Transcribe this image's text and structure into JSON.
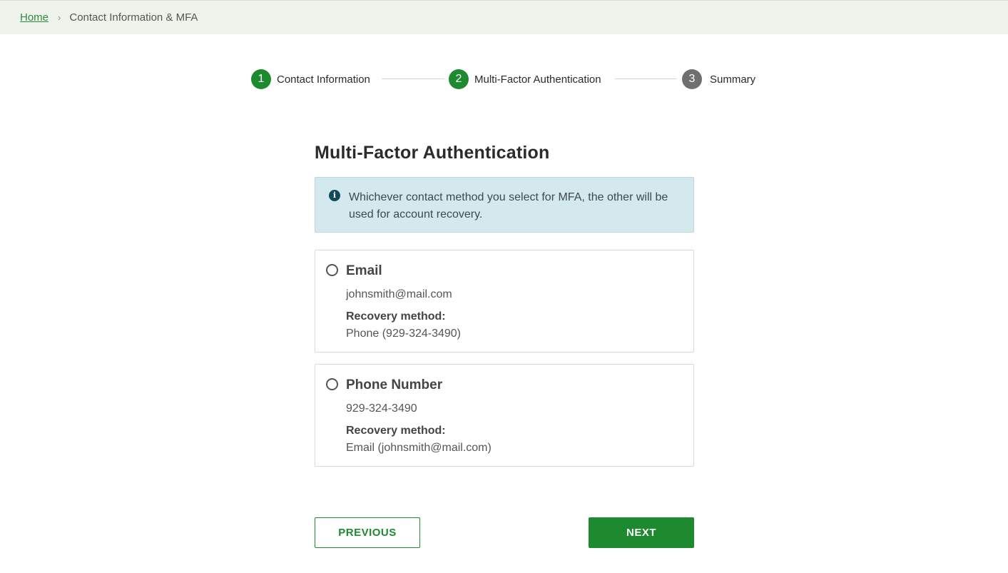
{
  "breadcrumb": {
    "home_label": "Home",
    "separator": "›",
    "current_label": "Contact Information & MFA"
  },
  "stepper": {
    "steps": [
      {
        "number": "1",
        "label": "Contact Information",
        "state": "done"
      },
      {
        "number": "2",
        "label": "Multi-Factor Authentication",
        "state": "active"
      },
      {
        "number": "3",
        "label": "Summary",
        "state": "pending"
      }
    ]
  },
  "main": {
    "title": "Multi-Factor Authentication",
    "alert": {
      "icon": "info-icon",
      "icon_glyph": "i",
      "text": "Whichever contact method you select for MFA, the other will be used for account recovery."
    },
    "options": [
      {
        "title": "Email",
        "value": "johnsmith@mail.com",
        "recovery_label": "Recovery method:",
        "recovery_value": "Phone (929-324-3490)",
        "selected": false
      },
      {
        "title": "Phone Number",
        "value": "929-324-3490",
        "recovery_label": "Recovery method:",
        "recovery_value": "Email (johnsmith@mail.com)",
        "selected": false
      }
    ]
  },
  "actions": {
    "previous_label": "PREVIOUS",
    "next_label": "NEXT"
  },
  "colors": {
    "primary_green": "#1e8a2f",
    "breadcrumb_bg": "#eef3ec",
    "alert_bg": "#d3e9ee",
    "step_pending": "#6f6f6f"
  }
}
